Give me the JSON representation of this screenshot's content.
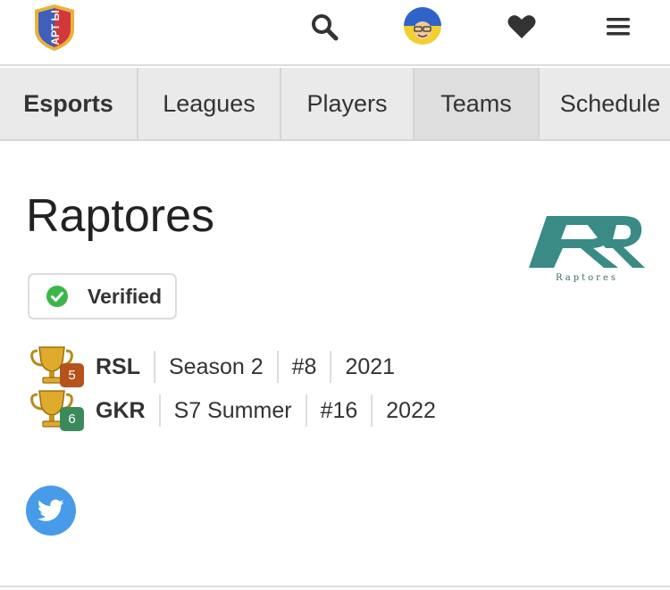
{
  "header": {
    "logo_icon": "arena-logo-icon",
    "logo_text": "АРТ ЬI",
    "search_icon": "search-icon",
    "avatar_icon": "avatar-icon",
    "heart_icon": "heart-icon",
    "menu_icon": "hamburger-menu-icon"
  },
  "tabs": [
    {
      "label": "Esports",
      "active": false,
      "bold": true
    },
    {
      "label": "Leagues",
      "active": false,
      "bold": false
    },
    {
      "label": "Players",
      "active": false,
      "bold": false
    },
    {
      "label": "Teams",
      "active": true,
      "bold": false
    },
    {
      "label": "Schedule",
      "active": false,
      "bold": false
    }
  ],
  "team": {
    "name": "Raptores",
    "logo_caption": "Raptores",
    "logo_color": "#3a8a86",
    "verified_label": "Verified",
    "verified_color": "#3cb64a"
  },
  "achievements": [
    {
      "league": "RSL",
      "season": "Season 2",
      "rank": "#8",
      "year": "2021",
      "badge": "5",
      "badge_color": "#b5531c"
    },
    {
      "league": "GKR",
      "season": "S7 Summer",
      "rank": "#16",
      "year": "2022",
      "badge": "6",
      "badge_color": "#3a8a5c"
    }
  ],
  "social": {
    "twitter_icon": "twitter-icon",
    "twitter_color": "#479be8"
  }
}
